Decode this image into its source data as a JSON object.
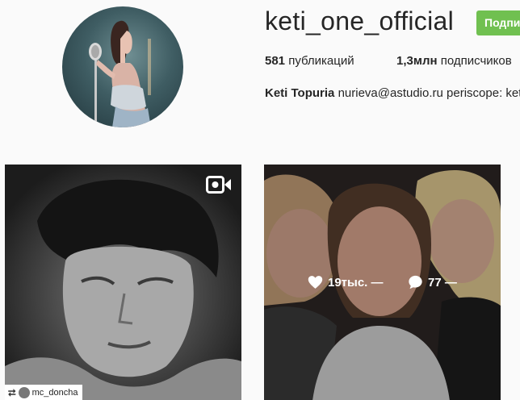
{
  "profile": {
    "username": "keti_one_official",
    "follow_label": "Подписаться",
    "posts_count": "581",
    "posts_label": "публикаций",
    "followers_count": "1,3млн",
    "followers_label": "подписчиков",
    "full_name": "Keti Topuria",
    "bio_text": "nurieva@astudio.ru periscope: keti_one"
  },
  "posts": [
    {
      "type": "video",
      "repost_user": "mc_doncha",
      "icon": "video-camera-icon"
    },
    {
      "type": "photo",
      "likes": "19тыс. —",
      "comments": "77 —",
      "icons": [
        "heart-icon",
        "comment-icon"
      ]
    }
  ],
  "colors": {
    "follow_button": "#70c050",
    "background": "#fafafa",
    "text": "#262626"
  }
}
